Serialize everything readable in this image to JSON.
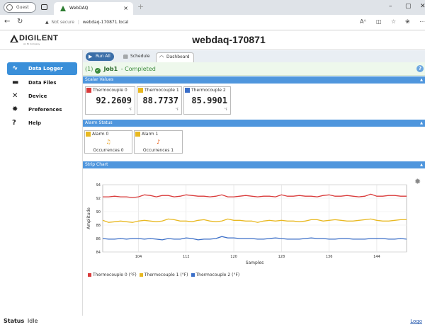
{
  "browser": {
    "profile": "Guest",
    "tab_title": "WebDAQ",
    "close_tab": "×",
    "new_tab": "+",
    "url_security": "Not secure",
    "url_host": "webdaq-170871.local"
  },
  "app": {
    "brand": "DIGILENT",
    "brand_sub": "An NI Company",
    "title": "webdaq-170871"
  },
  "sidebar": {
    "items": [
      {
        "label": "Data Logger",
        "icon": "pulse-icon",
        "glyph": "⁄\\⁄",
        "active": true
      },
      {
        "label": "Data Files",
        "icon": "folder-icon",
        "glyph": "▬",
        "active": false
      },
      {
        "label": "Device",
        "icon": "tools-icon",
        "glyph": "✕",
        "active": false
      },
      {
        "label": "Preferences",
        "icon": "gear-icon",
        "glyph": "✹",
        "active": false
      },
      {
        "label": "Help",
        "icon": "question-icon",
        "glyph": "?",
        "active": false
      }
    ]
  },
  "toolbar": {
    "run_all": "Run All",
    "schedule": "Schedule",
    "dashboard": "Dashboard"
  },
  "job": {
    "index": "(1)",
    "name": "Job1",
    "status": "- Completed"
  },
  "sections": {
    "scalar": "Scalar Values",
    "alarm": "Alarm Status",
    "strip": "Strip Chart"
  },
  "scalars": [
    {
      "name": "Thermocouple 0",
      "value": "92.2609",
      "unit": "°F",
      "color": "#d93a3a"
    },
    {
      "name": "Thermocouple 1",
      "value": "88.7737",
      "unit": "°F",
      "color": "#e8b820"
    },
    {
      "name": "Thermocouple 2",
      "value": "85.9901",
      "unit": "°F",
      "color": "#3a6ec8"
    }
  ],
  "alarms": [
    {
      "name": "Alarm 0",
      "occurrences": "Occurrences 0",
      "active": false,
      "color": "#e8b820"
    },
    {
      "name": "Alarm 1",
      "occurrences": "Occurrences 1",
      "active": true,
      "color": "#e8b820"
    }
  ],
  "chart_data": {
    "type": "line",
    "xlabel": "Samples",
    "ylabel": "Amplitude",
    "xlim": [
      98,
      149
    ],
    "ylim": [
      84,
      94
    ],
    "xticks": [
      104,
      112,
      120,
      128,
      136,
      144
    ],
    "yticks": [
      84,
      86,
      88,
      90,
      92,
      94
    ],
    "grid": true,
    "legend_position": "bottom-left",
    "series": [
      {
        "name": "Thermocouple 0 (°F)",
        "color": "#d93a3a",
        "values": [
          92.2,
          92.2,
          92.3,
          92.2,
          92.2,
          92.1,
          92.2,
          92.5,
          92.4,
          92.2,
          92.4,
          92.4,
          92.2,
          92.3,
          92.5,
          92.4,
          92.3,
          92.3,
          92.2,
          92.3,
          92.5,
          92.2,
          92.2,
          92.3,
          92.4,
          92.3,
          92.2,
          92.3,
          92.3,
          92.2,
          92.5,
          92.3,
          92.3,
          92.4,
          92.3,
          92.3,
          92.2,
          92.4,
          92.5,
          92.3,
          92.3,
          92.4,
          92.3,
          92.2,
          92.3,
          92.6,
          92.3,
          92.3,
          92.4,
          92.4,
          92.3,
          92.3
        ]
      },
      {
        "name": "Thermocouple 1 (°F)",
        "color": "#e8b820",
        "values": [
          88.7,
          88.4,
          88.5,
          88.6,
          88.5,
          88.4,
          88.6,
          88.7,
          88.6,
          88.5,
          88.6,
          88.9,
          88.8,
          88.6,
          88.6,
          88.5,
          88.7,
          88.8,
          88.6,
          88.5,
          88.6,
          88.9,
          88.7,
          88.7,
          88.6,
          88.6,
          88.4,
          88.6,
          88.7,
          88.6,
          88.7,
          88.6,
          88.6,
          88.5,
          88.6,
          88.8,
          88.8,
          88.6,
          88.7,
          88.8,
          88.7,
          88.6,
          88.6,
          88.7,
          88.8,
          88.9,
          88.7,
          88.6,
          88.6,
          88.7,
          88.8,
          88.8
        ]
      },
      {
        "name": "Thermocouple 2 (°F)",
        "color": "#3a6ec8",
        "values": [
          86.0,
          85.9,
          85.9,
          86.0,
          85.9,
          86.0,
          86.0,
          85.9,
          86.0,
          85.9,
          85.8,
          86.0,
          85.9,
          85.9,
          86.1,
          86.0,
          85.8,
          85.9,
          85.9,
          86.0,
          86.3,
          86.1,
          86.1,
          86.0,
          86.0,
          86.0,
          85.9,
          85.9,
          86.0,
          86.1,
          86.0,
          85.9,
          85.9,
          85.9,
          86.0,
          86.1,
          86.0,
          86.0,
          85.9,
          85.9,
          86.0,
          86.0,
          85.9,
          85.9,
          85.9,
          86.0,
          86.0,
          86.0,
          85.9,
          85.9,
          86.0,
          85.9
        ]
      }
    ]
  },
  "status": {
    "label": "Status",
    "value": "Idle",
    "logout": "Logo"
  }
}
